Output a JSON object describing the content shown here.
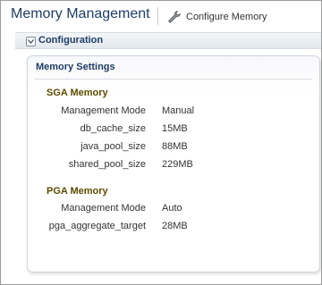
{
  "header": {
    "title": "Memory Management",
    "configure_label": "Configure Memory",
    "configure_icon": "wrench-icon"
  },
  "section": {
    "label": "Configuration",
    "toggle_icon": "chevron-down-icon",
    "expanded": true
  },
  "memory_settings": {
    "title": "Memory Settings",
    "sga": {
      "title": "SGA Memory",
      "rows": [
        {
          "label": "Management Mode",
          "value": "Manual"
        },
        {
          "label": "db_cache_size",
          "value": "15MB"
        },
        {
          "label": "java_pool_size",
          "value": "88MB"
        },
        {
          "label": "shared_pool_size",
          "value": "229MB"
        }
      ]
    },
    "pga": {
      "title": "PGA Memory",
      "rows": [
        {
          "label": "Management Mode",
          "value": "Auto"
        },
        {
          "label": "pga_aggregate_target",
          "value": "28MB"
        }
      ]
    }
  },
  "colors": {
    "title_blue": "#1d3d66",
    "group_title_brown": "#5e4a00"
  }
}
